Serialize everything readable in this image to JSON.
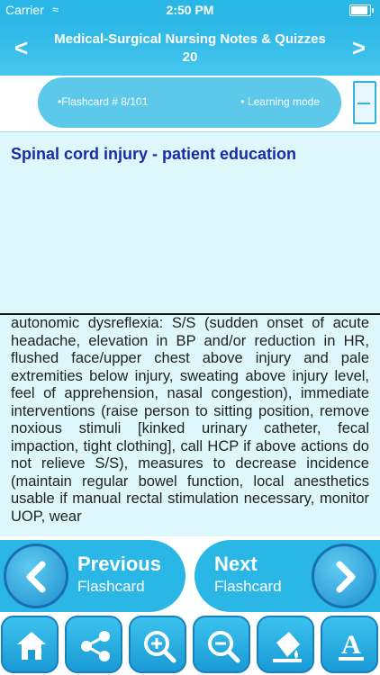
{
  "status": {
    "carrier": "Carrier",
    "time": "2:50 PM"
  },
  "nav": {
    "title": "Medical-Surgical Nursing Notes & Quizzes 20",
    "prev_glyph": "<",
    "next_glyph": ">"
  },
  "info": {
    "flashcard": "•Flashcard #  8/101",
    "mode": "• Learning mode"
  },
  "card": {
    "title": "Spinal cord injury - patient education",
    "body": "autonomic dysreflexia: S/S (sudden onset of acute headache, elevation in BP and/or reduction in HR, flushed face/upper chest above injury and pale extremities below injury, sweating above injury level, feel of apprehension, nasal congestion), immediate interventions (raise person to sitting position, remove noxious stimuli [kinked urinary catheter, fecal impaction, tight clothing], call HCP if above actions do not relieve S/S), measures to decrease incidence (maintain regular bowel function, local anesthetics usable if manual rectal stimulation necessary, monitor UOP, wear"
  },
  "pager": {
    "prev_line1": "Previous",
    "prev_line2": "Flashcard",
    "next_line1": "Next",
    "next_line2": "Flashcard"
  },
  "icons": {
    "home": "home-icon",
    "share": "share-icon",
    "zoom_in": "zoom-in-icon",
    "zoom_out": "zoom-out-icon",
    "paint": "paint-bucket-icon",
    "font": "font-icon"
  }
}
